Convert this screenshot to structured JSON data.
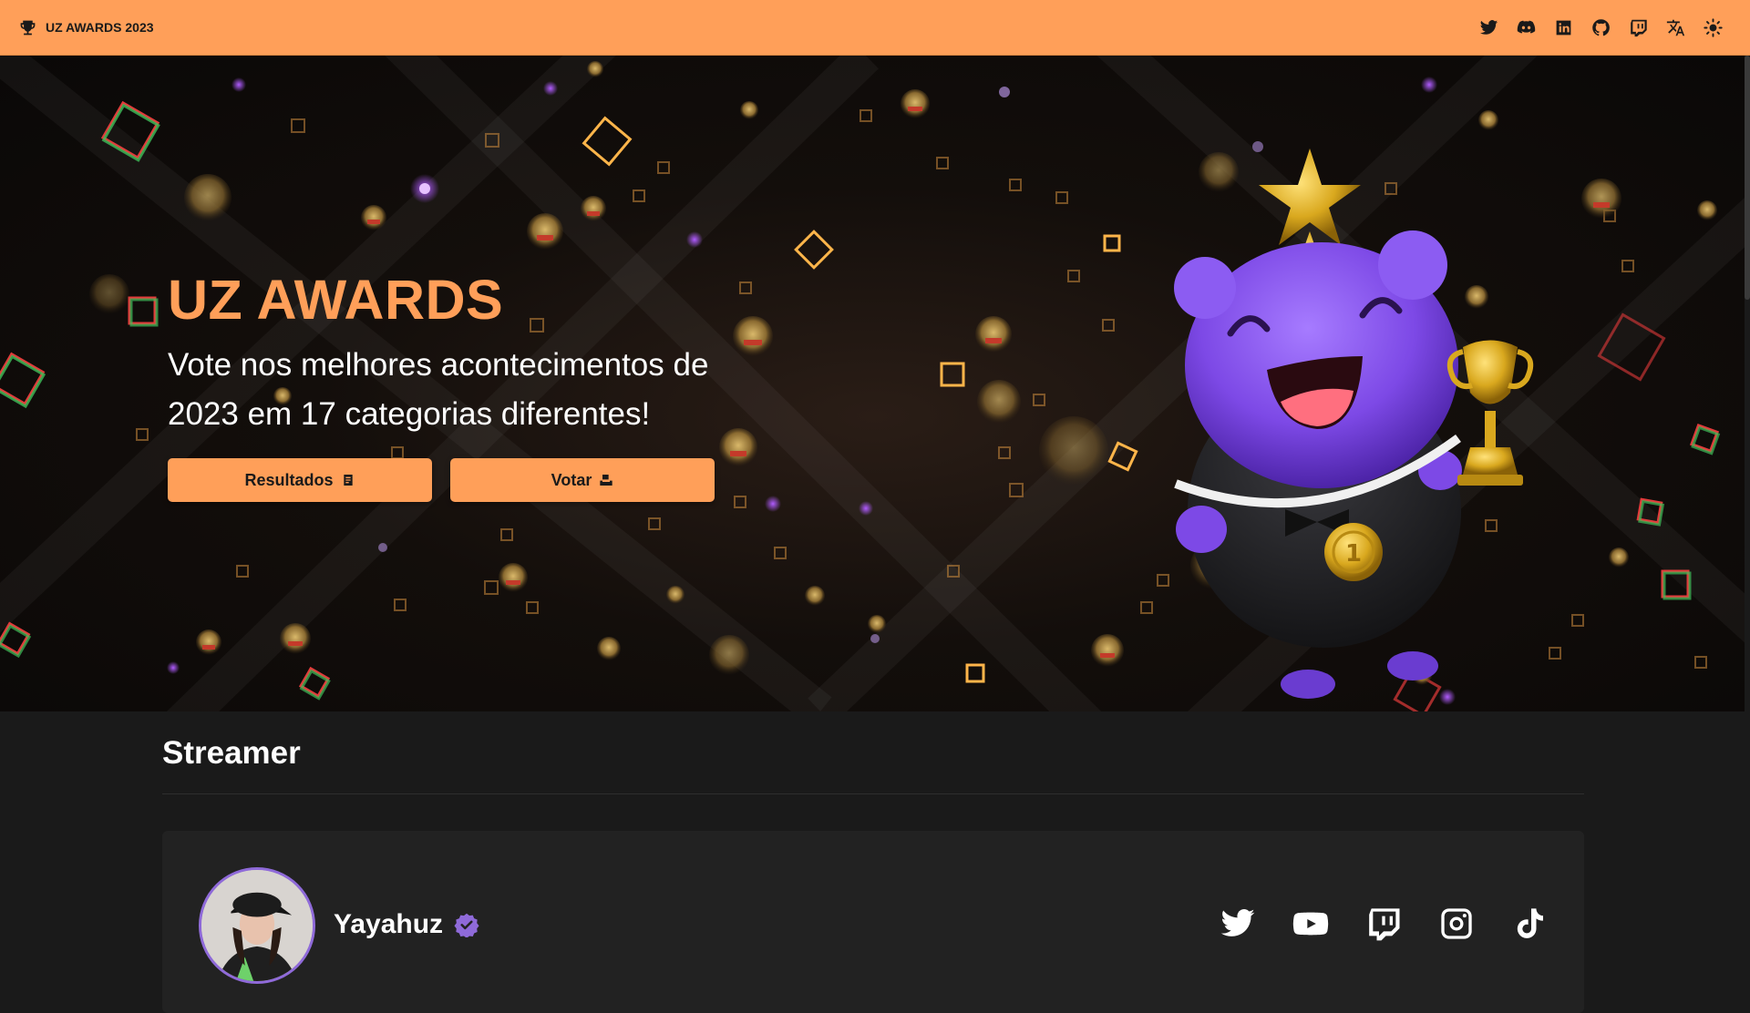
{
  "header": {
    "brand_label": "UZ AWARDS 2023",
    "icons": [
      "twitter-icon",
      "discord-icon",
      "linkedin-icon",
      "github-icon",
      "twitch-icon",
      "translate-icon",
      "theme-toggle-icon"
    ]
  },
  "hero": {
    "title": "UZ AWARDS",
    "subtitle": "Vote nos melhores acontecimentos de 2023 em 17 categorias diferentes!",
    "results_button": "Resultados",
    "vote_button": "Votar"
  },
  "section": {
    "title": "Streamer",
    "candidate": {
      "name": "Yayahuz",
      "socials": [
        "twitter-icon",
        "youtube-icon",
        "twitch-icon",
        "instagram-icon",
        "tiktok-icon"
      ]
    }
  },
  "colors": {
    "accent": "#ff9f59",
    "background": "#1a1a1a",
    "card": "#222222",
    "verified": "#8f6ad9"
  }
}
